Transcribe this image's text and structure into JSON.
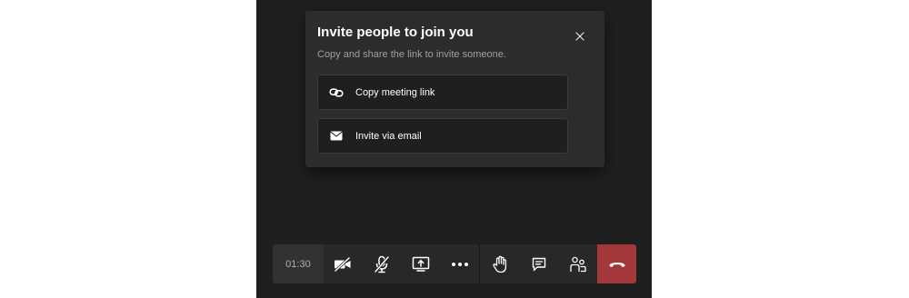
{
  "invite_dialog": {
    "title": "Invite people to join you",
    "subtitle": "Copy and share the link to invite someone.",
    "close_icon": "close-icon",
    "options": [
      {
        "label": "Copy meeting link",
        "icon": "link-icon"
      },
      {
        "label": "Invite via email",
        "icon": "mail-icon"
      }
    ]
  },
  "call_toolbar": {
    "timer": "01:30",
    "buttons": [
      {
        "icon": "camera-off-icon"
      },
      {
        "icon": "mic-off-icon"
      },
      {
        "icon": "share-screen-icon"
      },
      {
        "icon": "more-options-icon"
      },
      {
        "icon": "raise-hand-icon"
      },
      {
        "icon": "chat-icon"
      },
      {
        "icon": "participants-icon"
      },
      {
        "icon": "hang-up-icon"
      }
    ]
  },
  "colors": {
    "stage_background": "#201f1f",
    "dialog_background": "#2d2c2c",
    "hangup_red": "#a4373a",
    "text_primary": "#ffffff",
    "text_secondary": "#a19f9d"
  }
}
